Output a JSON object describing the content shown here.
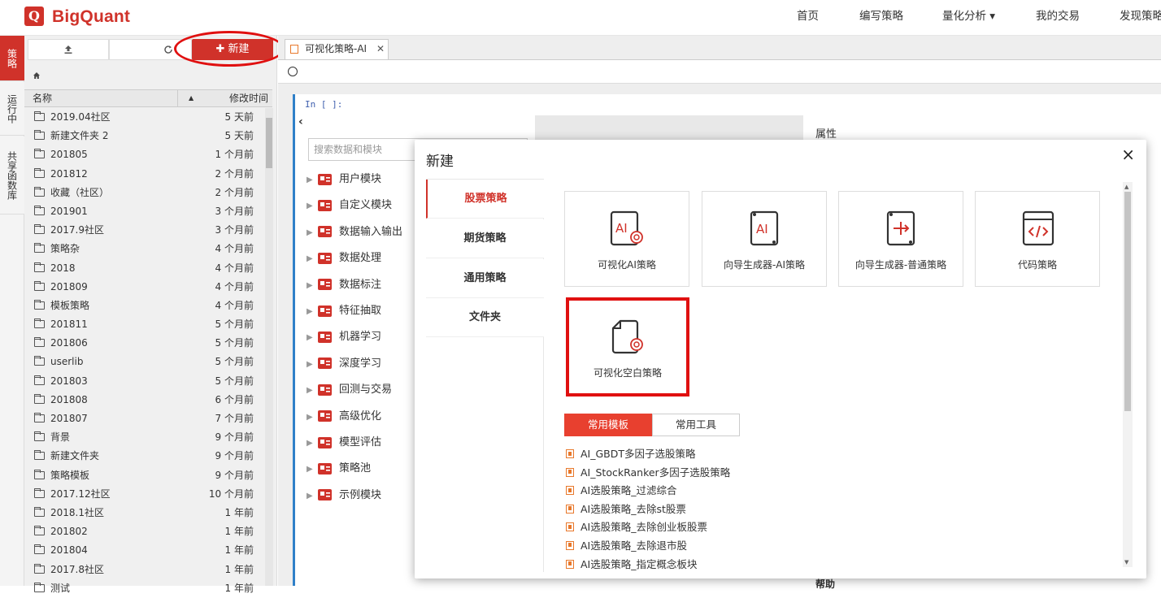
{
  "brand": {
    "logo_letter": "Q",
    "name": "BigQuant",
    "accent": "#d0322a"
  },
  "nav": [
    {
      "label": "首页"
    },
    {
      "label": "编写策略"
    },
    {
      "label": "量化分析 ▾"
    },
    {
      "label": "我的交易"
    },
    {
      "label": "发现策略"
    }
  ],
  "left_tabs": [
    "策略",
    "运行中",
    "共享函数库"
  ],
  "sidebar": {
    "new_label": "✚ 新建",
    "upload_icon": "upload-icon",
    "refresh_icon": "refresh-icon",
    "col_name": "名称",
    "col_sort": "▲",
    "col_time": "修改时间",
    "files": [
      {
        "name": "2019.04社区",
        "time": "5 天前"
      },
      {
        "name": "新建文件夹 2",
        "time": "5 天前"
      },
      {
        "name": "201805",
        "time": "1 个月前"
      },
      {
        "name": "201812",
        "time": "2 个月前"
      },
      {
        "name": "收藏（社区）",
        "time": "2 个月前"
      },
      {
        "name": "201901",
        "time": "3 个月前"
      },
      {
        "name": "2017.9社区",
        "time": "3 个月前"
      },
      {
        "name": "策略杂",
        "time": "4 个月前"
      },
      {
        "name": "2018",
        "time": "4 个月前"
      },
      {
        "name": "201809",
        "time": "4 个月前"
      },
      {
        "name": "模板策略",
        "time": "4 个月前"
      },
      {
        "name": "201811",
        "time": "5 个月前"
      },
      {
        "name": "201806",
        "time": "5 个月前"
      },
      {
        "name": "userlib",
        "time": "5 个月前"
      },
      {
        "name": "201803",
        "time": "5 个月前"
      },
      {
        "name": "201808",
        "time": "6 个月前"
      },
      {
        "name": "201807",
        "time": "7 个月前"
      },
      {
        "name": "背景",
        "time": "9 个月前"
      },
      {
        "name": "新建文件夹",
        "time": "9 个月前"
      },
      {
        "name": "策略模板",
        "time": "9 个月前"
      },
      {
        "name": "2017.12社区",
        "time": "10 个月前"
      },
      {
        "name": "2018.1社区",
        "time": "1 年前"
      },
      {
        "name": "201802",
        "time": "1 年前"
      },
      {
        "name": "201804",
        "time": "1 年前"
      },
      {
        "name": "2017.8社区",
        "time": "1 年前"
      },
      {
        "name": "测试",
        "time": "1 年前"
      }
    ]
  },
  "editor": {
    "tab_label": "可视化策略-AI",
    "tab_close": "✕",
    "in_label": "In [ ]:",
    "search_placeholder": "搜索数据和模块",
    "modules": [
      "用户模块",
      "自定义模块",
      "数据输入输出",
      "数据处理",
      "数据标注",
      "特征抽取",
      "机器学习",
      "深度学习",
      "回测与交易",
      "高级优化",
      "模型评估",
      "策略池",
      "示例模块"
    ],
    "props_label": "属性",
    "help_label": "帮助"
  },
  "modal": {
    "title": "新建",
    "close": "×",
    "categories": [
      "股票策略",
      "期货策略",
      "通用策略",
      "文件夹"
    ],
    "cards": [
      "可视化AI策略",
      "向导生成器-AI策略",
      "向导生成器-普通策略",
      "代码策略",
      "可视化空白策略"
    ],
    "seg_tabs": [
      "常用模板",
      "常用工具"
    ],
    "templates": [
      "AI_GBDT多因子选股策略",
      "AI_StockRanker多因子选股策略",
      "AI选股策略_过滤综合",
      "AI选股策略_去除st股票",
      "AI选股策略_去除创业板股票",
      "AI选股策略_去除退市股",
      "AI选股策略_指定概念板块"
    ]
  }
}
